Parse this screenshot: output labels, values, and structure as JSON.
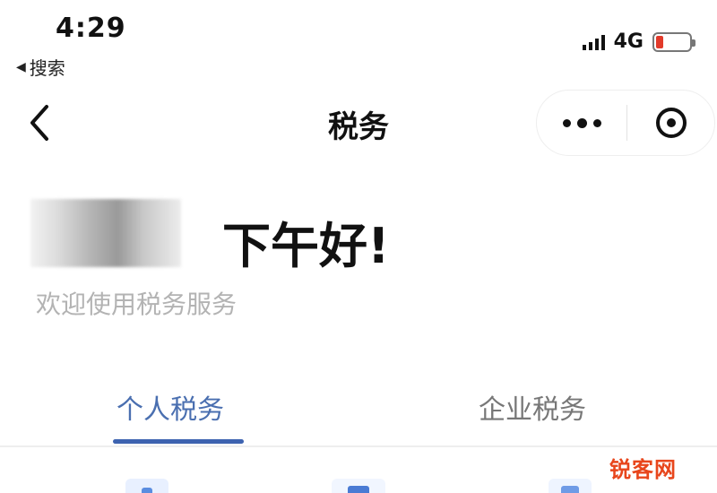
{
  "status_bar": {
    "time": "4:29",
    "back_app": "搜索",
    "network": "4G"
  },
  "nav": {
    "title": "税务"
  },
  "greeting": {
    "title": "下午好!",
    "subtitle": "欢迎使用税务服务"
  },
  "tabs": [
    {
      "label": "个人税务",
      "active": true
    },
    {
      "label": "企业税务",
      "active": false
    }
  ],
  "colors": {
    "accent": "#3d63b0",
    "active_tab_text": "#4a6fb0",
    "battery_low": "#e23a2a",
    "watermark": "#e8461c"
  },
  "watermark": "锐客网"
}
